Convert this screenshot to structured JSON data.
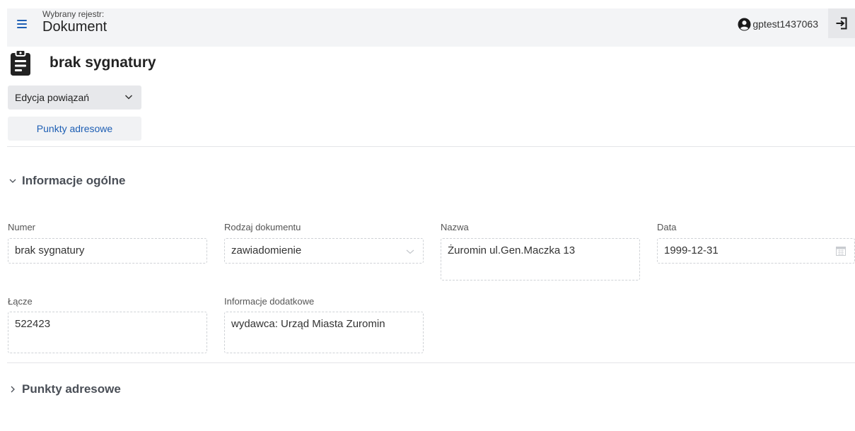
{
  "header": {
    "registry_caption": "Wybrany rejestr:",
    "registry_name": "Dokument",
    "username": "gptest1437063"
  },
  "document": {
    "title": "brak sygnatury"
  },
  "actions": {
    "dropdown_label": "Edycja powiązań",
    "link_label": "Punkty adresowe"
  },
  "sections": {
    "general": {
      "title": "Informacje ogólne",
      "fields": {
        "numer": {
          "label": "Numer",
          "value": "brak sygnatury"
        },
        "rodzaj": {
          "label": "Rodzaj dokumentu",
          "value": "zawiadomienie"
        },
        "nazwa": {
          "label": "Nazwa",
          "value": "Żuromin ul.Gen.Maczka 13"
        },
        "data": {
          "label": "Data",
          "value": "1999-12-31"
        },
        "lacze": {
          "label": "Łącze",
          "value": "522423"
        },
        "info": {
          "label": "Informacje dodatkowe",
          "value": "wydawca: Urząd Miasta Zuromin"
        }
      }
    },
    "addresses": {
      "title": "Punkty adresowe"
    }
  },
  "colors": {
    "accent": "#1e5fb4",
    "topbar_bg": "#f3f4f6",
    "button_bg": "#e7e8eb"
  },
  "icons": {
    "menu": "hamburger-icon",
    "user": "user-circle-icon",
    "logout": "logout-icon",
    "document": "clipboard-icon",
    "chevron": "chevron-down-icon",
    "calendar": "calendar-icon"
  }
}
